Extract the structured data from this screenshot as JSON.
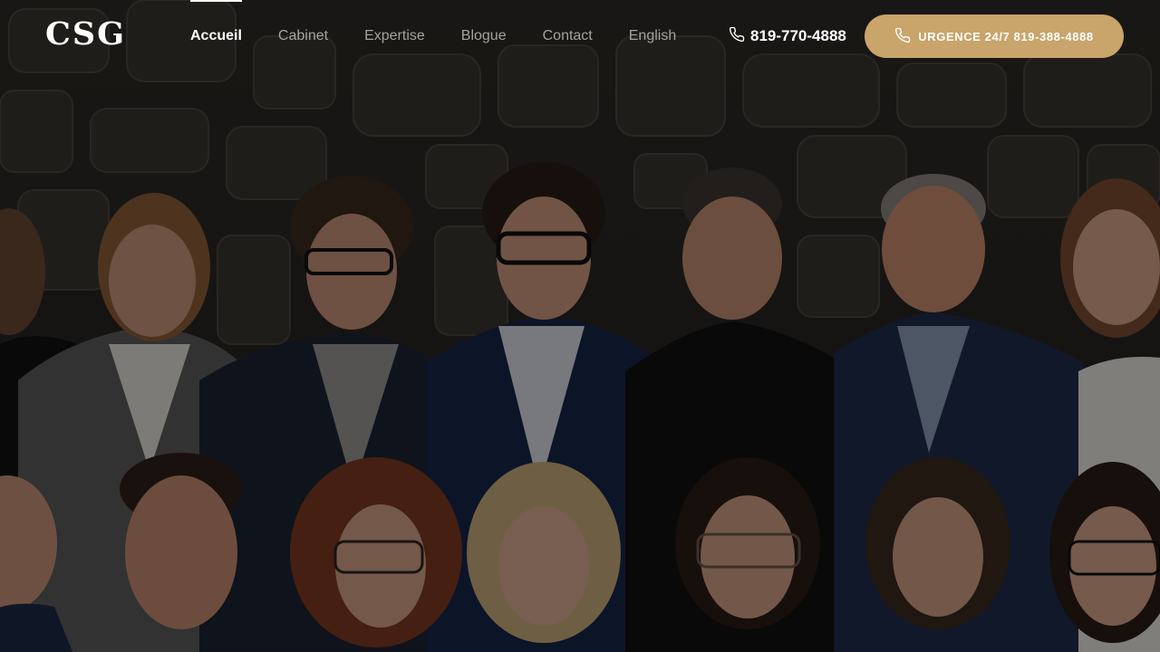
{
  "brand": {
    "logo_text": "CSG"
  },
  "nav": {
    "items": [
      {
        "label": "Accueil",
        "active": true
      },
      {
        "label": "Cabinet"
      },
      {
        "label": "Expertise"
      },
      {
        "label": "Blogue"
      },
      {
        "label": "Contact"
      }
    ],
    "language_label": "English"
  },
  "contact": {
    "phone_icon": "phone-icon",
    "phone": "819-770-4888",
    "urgent_label": "URGENCE 24/7 819-388-4888"
  },
  "hero": {
    "image": "team-photo-stone-wall"
  },
  "colors": {
    "accent": "#c9a46b",
    "nav_inactive": "#a6a29d",
    "text": "#ffffff"
  }
}
